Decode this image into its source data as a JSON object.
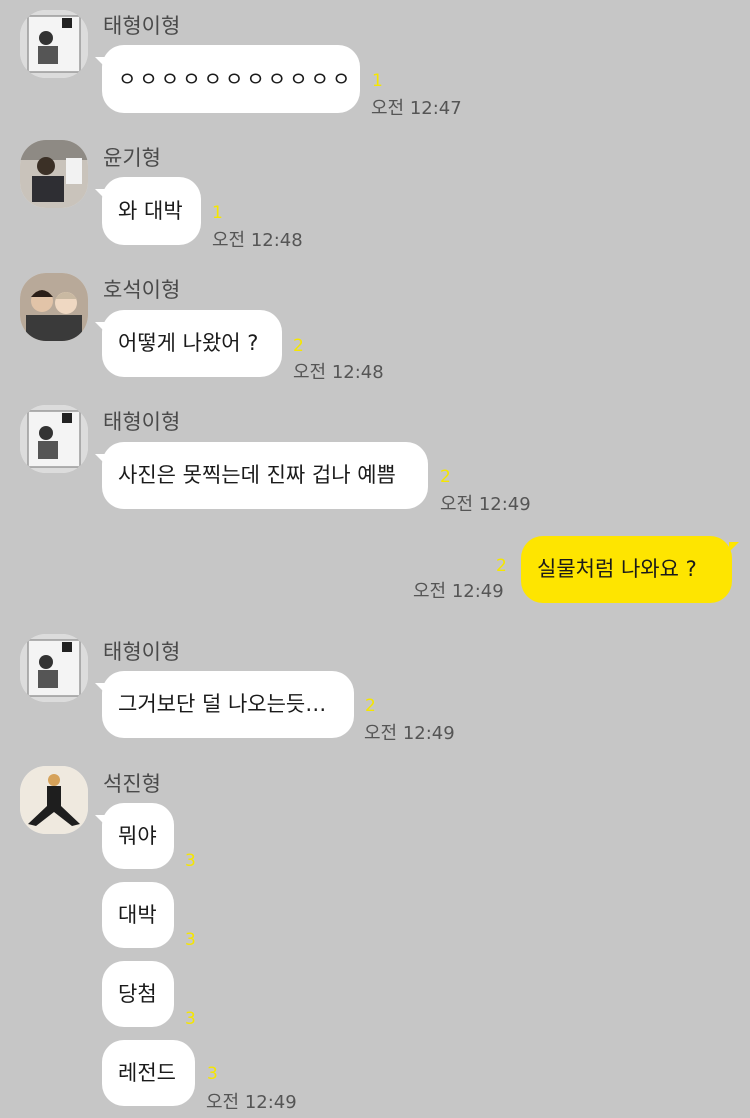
{
  "messages": [
    {
      "sender": "태형이형",
      "text": "ㅇㅇㅇㅇㅇㅇㅇㅇㅇㅇㅇ",
      "unread": "1",
      "time": "오전 12:47"
    },
    {
      "sender": "윤기형",
      "text": "와 대박",
      "unread": "1",
      "time": "오전 12:48"
    },
    {
      "sender": "호석이형",
      "text": "어떻게 나왔어 ?",
      "unread": "2",
      "time": "오전 12:48"
    },
    {
      "sender": "태형이형",
      "text": "사진은 못찍는데 진짜 겁나 예쁨",
      "unread": "2",
      "time": "오전 12:49"
    },
    {
      "sender": "",
      "text": "실물처럼 나와요 ?",
      "unread": "2",
      "time": "오전 12:49"
    },
    {
      "sender": "태형이형",
      "text": "그거보단 덜 나오는듯…",
      "unread": "2",
      "time": "오전 12:49"
    },
    {
      "sender": "석진형",
      "text": "뭐야",
      "unread": "3",
      "time": ""
    },
    {
      "sender": "",
      "text": "대박",
      "unread": "3",
      "time": ""
    },
    {
      "sender": "",
      "text": "당첨",
      "unread": "3",
      "time": ""
    },
    {
      "sender": "",
      "text": "레전드",
      "unread": "3",
      "time": "오전 12:49"
    }
  ],
  "colors": {
    "background": "#c6c6c6",
    "incoming_bubble": "#ffffff",
    "outgoing_bubble": "#fee500",
    "unread_count": "#f5e600"
  },
  "avatars": [
    "taehyung-photo",
    "yoongi-photo",
    "hoseok-photo",
    "taehyung-photo",
    "taehyung-photo",
    "seokjin-photo"
  ]
}
